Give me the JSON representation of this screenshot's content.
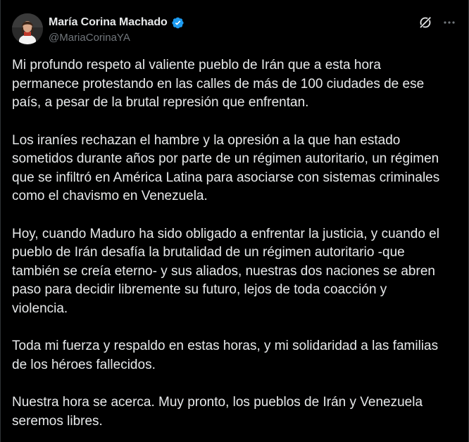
{
  "author": {
    "display_name": "María Corina Machado",
    "handle": "@MariaCorinaYA"
  },
  "icons": {
    "verified": "verified-badge-icon",
    "grok": "grok-icon",
    "more": "more-options-icon"
  },
  "colors": {
    "background": "#000000",
    "text": "#e7e9ea",
    "secondary_text": "#71767b",
    "verified_badge": "#1d9bf0"
  },
  "post": {
    "paragraphs": [
      "Mi profundo respeto al valiente pueblo de Irán que a esta hora\npermanece protestando en las calles de más de 100 ciudades de ese\npaís, a pesar de la brutal represión que enfrentan.",
      "Los iraníes rechazan el hambre y la opresión a la que han estado\nsometidos durante años por parte de un régimen autoritario, un régimen\nque se infiltró en América Latina para asociarse con sistemas criminales\ncomo el chavismo en Venezuela.",
      "Hoy, cuando Maduro ha sido obligado a enfrentar la justicia, y cuando el\npueblo de Irán desafía la brutalidad de un régimen autoritario -que\ntambién se creía eterno- y sus aliados, nuestras dos naciones se abren\npaso para decidir libremente su futuro, lejos de toda coacción y\nviolencia.",
      "Toda mi fuerza y respaldo en estas horas, y mi solidaridad a las familias\nde los héroes fallecidos.",
      "Nuestra hora se acerca. Muy pronto, los pueblos de Irán y Venezuela\nseremos libres."
    ]
  }
}
